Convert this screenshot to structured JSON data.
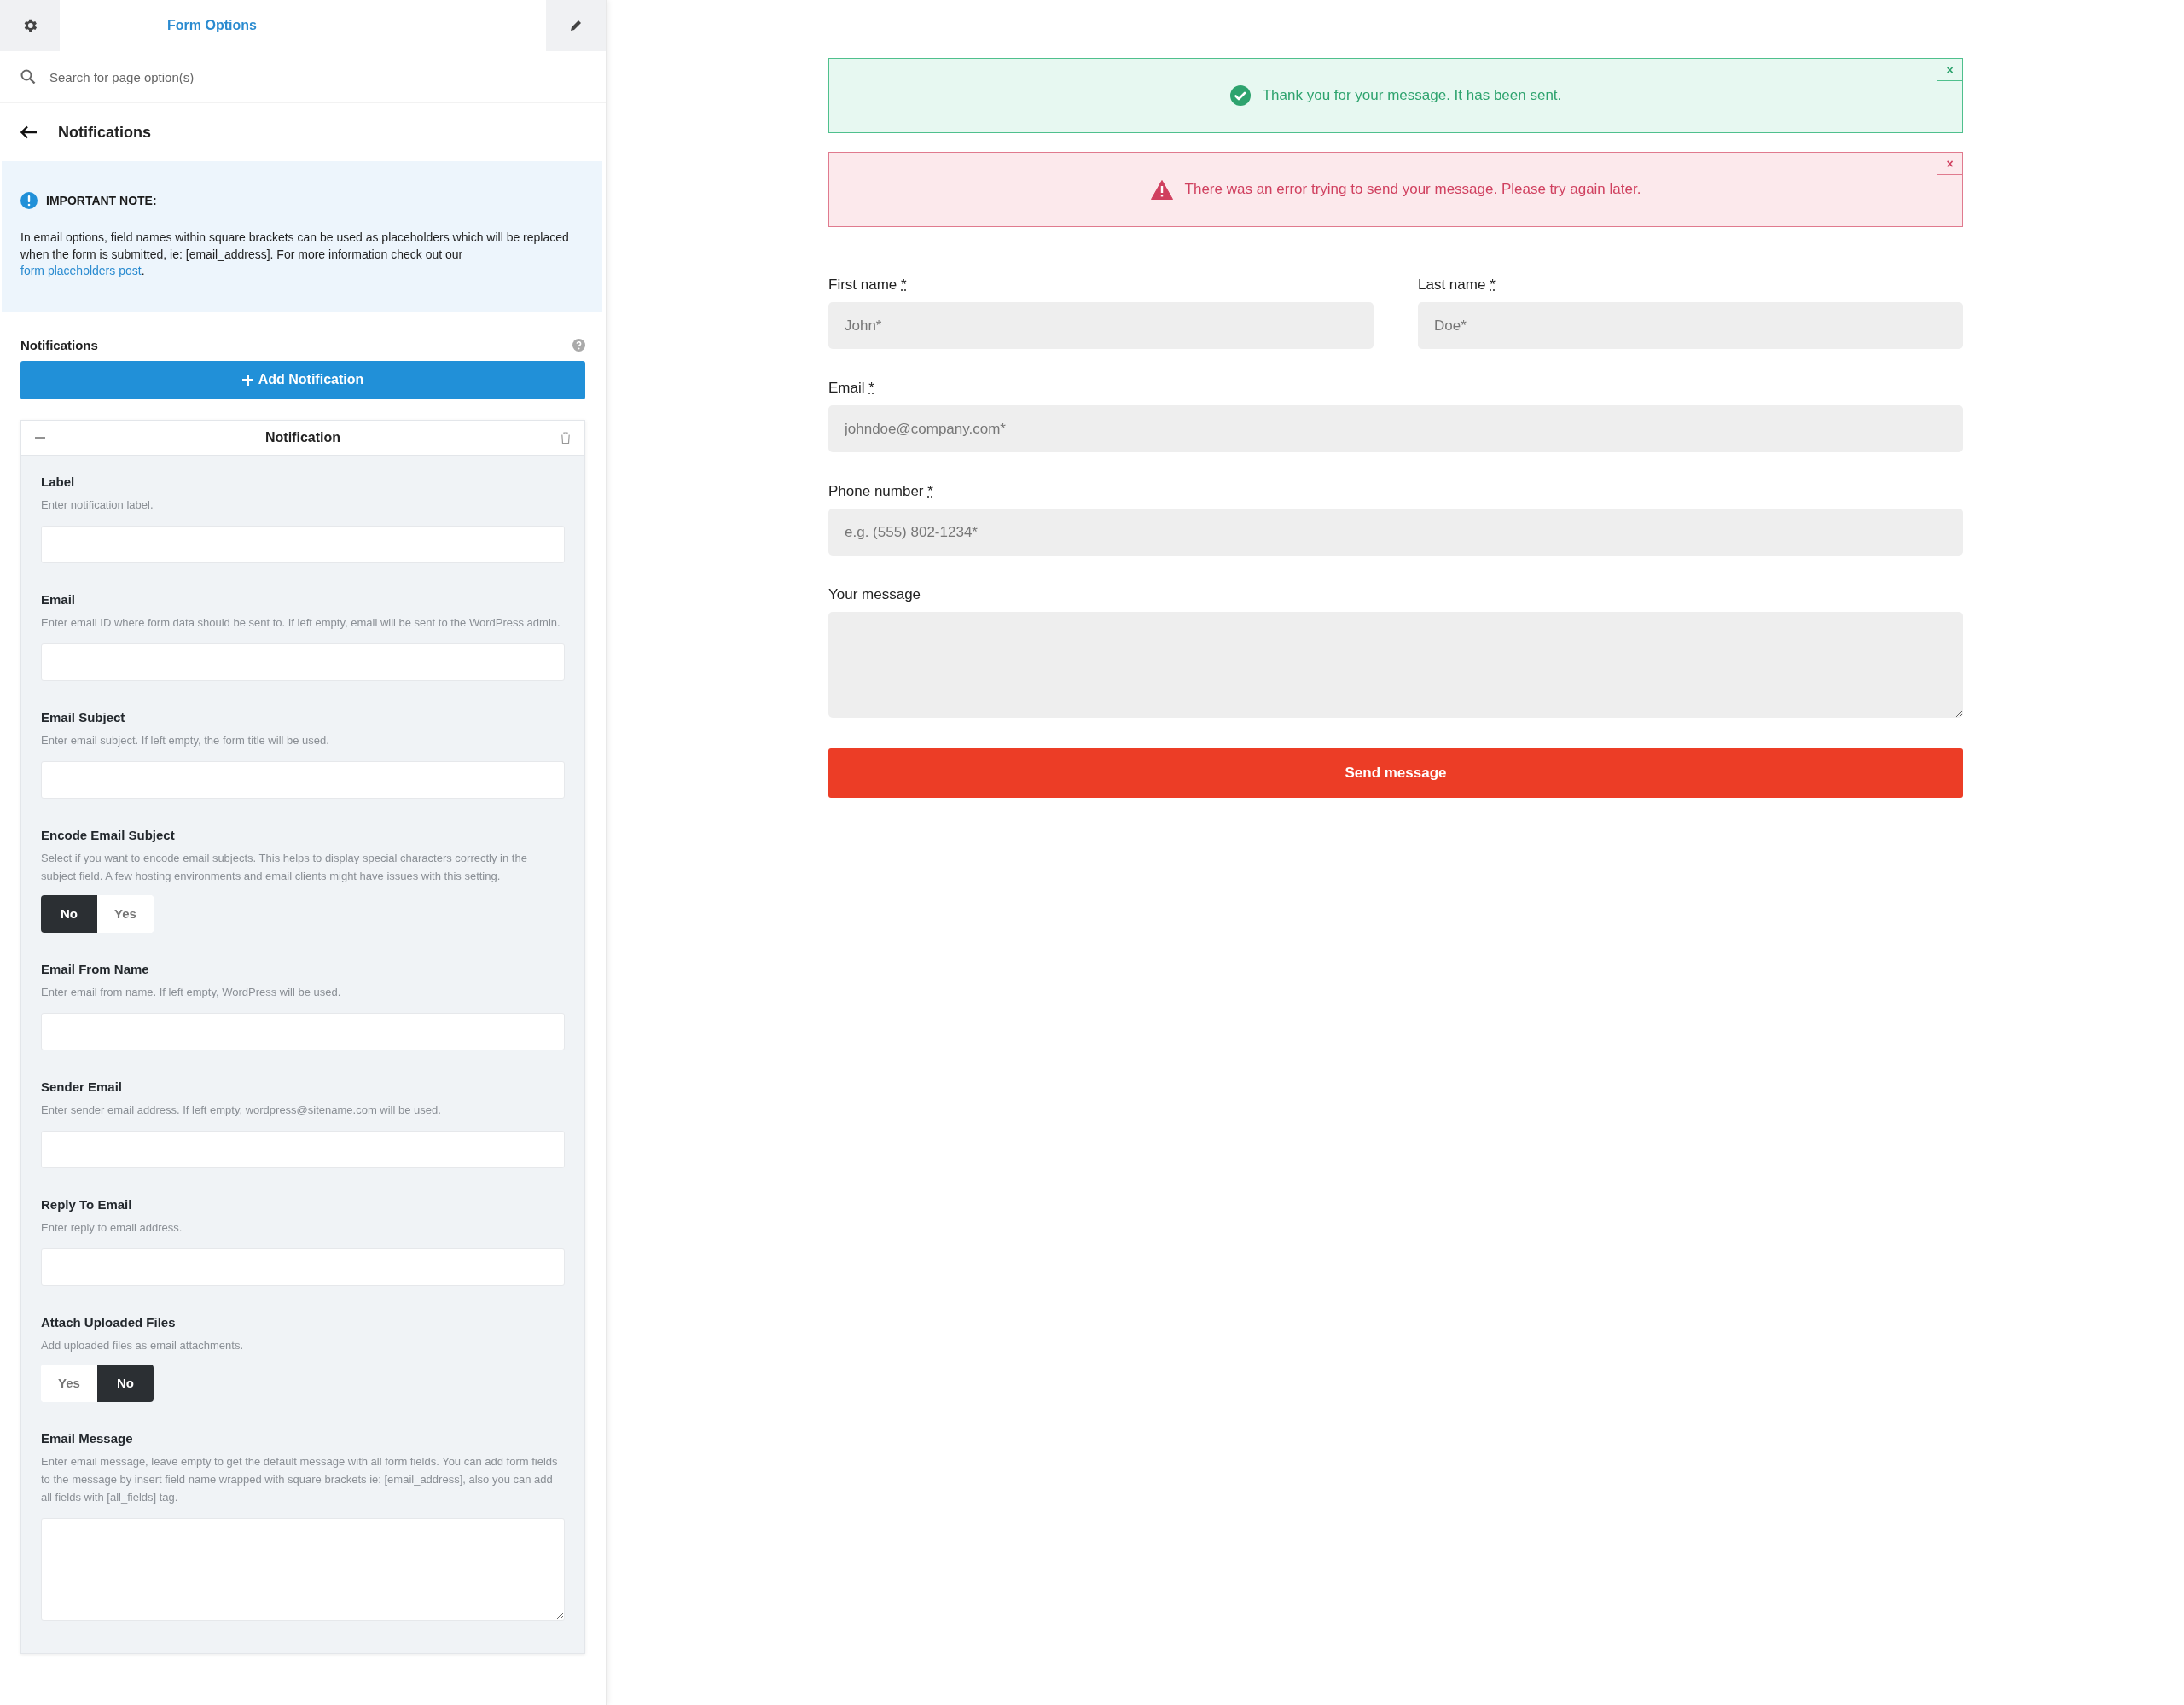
{
  "header": {
    "title": "Form Options"
  },
  "search": {
    "placeholder": "Search for page option(s)"
  },
  "section": {
    "title": "Notifications"
  },
  "note": {
    "heading": "IMPORTANT NOTE:",
    "text": "In email options, field names within square brackets can be used as placeholders which will be replaced when the form is submitted, ie: [email_address]. For more information check out our ",
    "link": "form placeholders post",
    "after": "."
  },
  "notifications": {
    "label": "Notifications",
    "add_button": "Add Notification"
  },
  "card": {
    "title": "Notification",
    "fields": [
      {
        "kind": "text",
        "label": "Label",
        "description": "Enter notification label."
      },
      {
        "kind": "text",
        "label": "Email",
        "description": "Enter email ID where form data should be sent to. If left empty, email will be sent to the WordPress admin."
      },
      {
        "kind": "text",
        "label": "Email Subject",
        "description": "Enter email subject. If left empty, the form title will be used."
      },
      {
        "kind": "toggle",
        "label": "Encode Email Subject",
        "description": "Select if you want to encode email subjects. This helps to display special characters correctly in the subject field. A few hosting environments and email clients might have issues with this setting.",
        "options": [
          {
            "label": "No",
            "selected": true
          },
          {
            "label": "Yes",
            "selected": false
          }
        ]
      },
      {
        "kind": "text",
        "label": "Email From Name",
        "description": "Enter email from name. If left empty, WordPress will be used."
      },
      {
        "kind": "text",
        "label": "Sender Email",
        "description": "Enter sender email address. If left empty, wordpress@sitename.com will be used."
      },
      {
        "kind": "text",
        "label": "Reply To Email",
        "description": "Enter reply to email address."
      },
      {
        "kind": "toggle",
        "label": "Attach Uploaded Files",
        "description": "Add uploaded files as email attachments.",
        "options": [
          {
            "label": "Yes",
            "selected": false
          },
          {
            "label": "No",
            "selected": true
          }
        ]
      },
      {
        "kind": "textarea",
        "label": "Email Message",
        "description": "Enter email message, leave empty to get the default message with all form fields. You can add form fields to the message by insert field name wrapped with square brackets ie: [email_address], also you can add all fields with [all_fields] tag."
      }
    ]
  },
  "alerts": [
    {
      "kind": "success",
      "text": "Thank you for your message. It has been sent.",
      "close": "×"
    },
    {
      "kind": "error",
      "text": "There was an error trying to send your message. Please try again later.",
      "close": "×"
    }
  ],
  "form": {
    "rows": [
      [
        {
          "kind": "text",
          "label": "First name",
          "required_mark": "*",
          "placeholder": "John*"
        },
        {
          "kind": "text",
          "label": "Last name",
          "required_mark": "*",
          "placeholder": "Doe*"
        }
      ],
      [
        {
          "kind": "text",
          "label": "Email",
          "required_mark": "*",
          "placeholder": "johndoe@company.com*"
        }
      ],
      [
        {
          "kind": "text",
          "label": "Phone number",
          "required_mark": "*",
          "placeholder": "e.g. (555) 802-1234*"
        }
      ],
      [
        {
          "kind": "textarea",
          "label": "Your message"
        }
      ]
    ],
    "submit": "Send message"
  }
}
